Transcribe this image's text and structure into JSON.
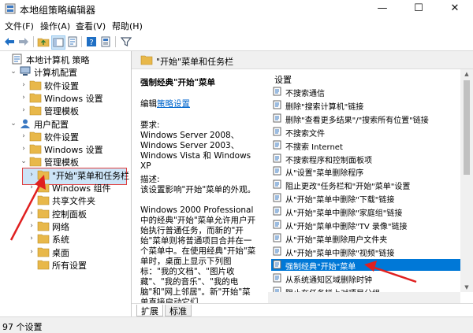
{
  "window": {
    "title": "本地组策略编辑器",
    "minimize": "—",
    "maximize": "☐",
    "close": "✕"
  },
  "menu": [
    "文件(F)",
    "操作(A)",
    "查看(V)",
    "帮助(H)"
  ],
  "toolbar_icons": [
    "back-arrow-icon",
    "forward-arrow-icon",
    "up-folder-icon",
    "show-tree-icon",
    "export-list-icon",
    "help-icon",
    "properties-icon",
    "filter-icon"
  ],
  "tree": {
    "items": [
      {
        "label": "本地计算机 策略",
        "icon": "computer-policy-icon",
        "level": 0,
        "expand": ""
      },
      {
        "label": "计算机配置",
        "icon": "computer-icon",
        "level": 1,
        "expand": "⌄"
      },
      {
        "label": "软件设置",
        "icon": "folder-icon",
        "level": 2,
        "expand": "›"
      },
      {
        "label": "Windows 设置",
        "icon": "folder-icon",
        "level": 2,
        "expand": "›"
      },
      {
        "label": "管理模板",
        "icon": "folder-icon",
        "level": 2,
        "expand": "›"
      },
      {
        "label": "用户配置",
        "icon": "user-icon",
        "level": 1,
        "expand": "⌄"
      },
      {
        "label": "软件设置",
        "icon": "folder-icon",
        "level": 2,
        "expand": "›"
      },
      {
        "label": "Windows 设置",
        "icon": "folder-icon",
        "level": 2,
        "expand": "›"
      },
      {
        "label": "管理模板",
        "icon": "folder-icon",
        "level": 2,
        "expand": "⌄"
      },
      {
        "label": "\"开始\"菜单和任务栏",
        "icon": "folder-icon",
        "level": 3,
        "expand": "›"
      },
      {
        "label": "Windows 组件",
        "icon": "folder-icon",
        "level": 3,
        "expand": "›"
      },
      {
        "label": "共享文件夹",
        "icon": "folder-icon",
        "level": 3,
        "expand": ""
      },
      {
        "label": "控制面板",
        "icon": "folder-icon",
        "level": 3,
        "expand": "›"
      },
      {
        "label": "网络",
        "icon": "folder-icon",
        "level": 3,
        "expand": "›"
      },
      {
        "label": "系统",
        "icon": "folder-icon",
        "level": 3,
        "expand": "›"
      },
      {
        "label": "桌面",
        "icon": "folder-icon",
        "level": 3,
        "expand": "›"
      },
      {
        "label": "所有设置",
        "icon": "folder-icon",
        "level": 3,
        "expand": ""
      }
    ],
    "selected_index": 9
  },
  "header": {
    "title": "\"开始\"菜单和任务栏",
    "icon": "folder-icon"
  },
  "description": {
    "title": "强制经典\"开始\"菜单",
    "edit_prefix": "编辑",
    "edit_link": "策略设置",
    "requirements_label": "要求:",
    "requirements": "Windows Server 2008、Windows Server 2003、Windows Vista 和 Windows XP",
    "desc_label": "描述:",
    "desc_short": "该设置影响\"开始\"菜单的外观。",
    "desc_long": "Windows 2000 Professional 中的经典\"开始\"菜单允许用户开始执行普通任务，而新的\"开始\"菜单则将普通项目合并在一个菜单中。在使用经典\"开始\"菜单时，桌面上显示下列图标：\"我的文档\"、\"图片收藏\"、\"我的音乐\"、\"我的电脑\"和\"网上邻居\"。新\"开始\"菜单直接启动它们。"
  },
  "settings_list": {
    "column_header": "设置",
    "items": [
      "不搜索通信",
      "删除\"搜索计算机\"链接",
      "删除\"查看更多结果\"/\"搜索所有位置\"链接",
      "不搜索文件",
      "不搜索 Internet",
      "不搜索程序和控制面板项",
      "从\"设置\"菜单删除程序",
      "阻止更改\"任务栏和\"开始\"菜单\"设置",
      "从\"开始\"菜单中删除\"下载\"链接",
      "从\"开始\"菜单中删除\"家庭组\"链接",
      "从\"开始\"菜单中删除\"TV 录像\"链接",
      "从\"开始\"菜单删除用户文件夹",
      "从\"开始\"菜单中删除\"视频\"链接",
      "强制经典\"开始\"菜单",
      "从系统通知区域删除时钟",
      "阻止在任务栏上对项目分组"
    ],
    "selected_index": 13
  },
  "tabs": [
    "扩展",
    "标准"
  ],
  "status": "97 个设置",
  "colors": {
    "selection": "#0078d7",
    "tree_selection": "#cce4f7",
    "annotation": "#e02020",
    "folder": "#e8b84a"
  }
}
